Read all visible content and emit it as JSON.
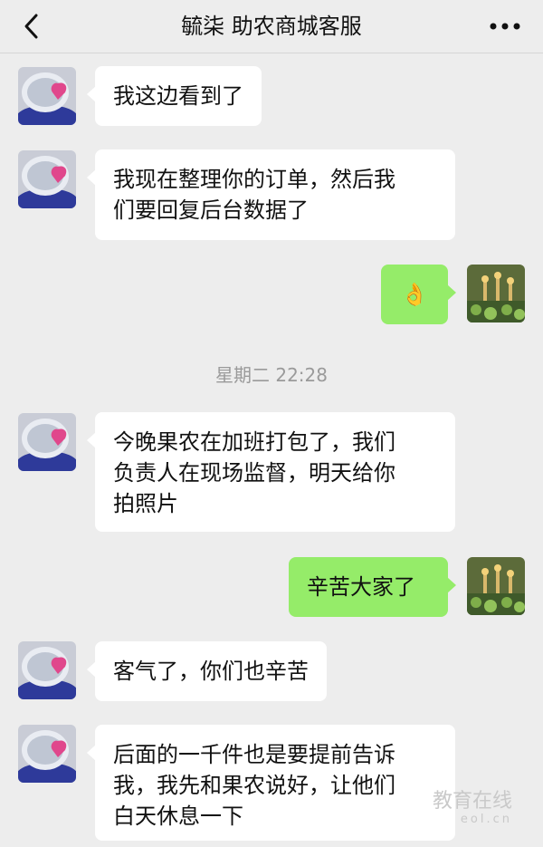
{
  "header": {
    "title": "毓柒 助农商城客服",
    "back_icon": "chevron-left-icon",
    "more_icon": "more-dots-icon"
  },
  "messages": [
    {
      "side": "left",
      "text": "我这边看到了"
    },
    {
      "side": "left",
      "text": "我现在整理你的订单，然后我\n们要回复后台数据了"
    },
    {
      "side": "right",
      "text": "👌"
    },
    {
      "side": "left",
      "text": "今晚果农在加班打包了，我们\n负责人在现场监督，明天给你\n拍照片"
    },
    {
      "side": "right",
      "text": "辛苦大家了"
    },
    {
      "side": "left",
      "text": "客气了，你们也辛苦"
    },
    {
      "side": "left",
      "text": "后面的一千件也是要提前告诉\n我，我先和果农说好，让他们\n白天休息一下"
    }
  ],
  "timestamp": "星期二 22:28",
  "watermark": {
    "main": "教育在线",
    "sub": "eol.cn"
  },
  "colors": {
    "background": "#ededed",
    "bubble_left": "#ffffff",
    "bubble_right": "#95ec69",
    "timestamp": "#9a9a9a"
  }
}
